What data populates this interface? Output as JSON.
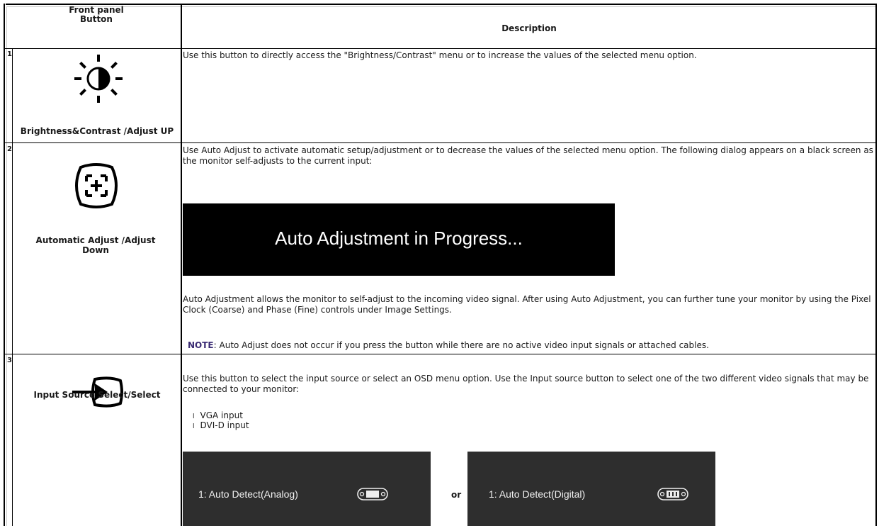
{
  "header": {
    "col1": "Front panel\nButton",
    "col2": "Description"
  },
  "rows": [
    {
      "num": "1",
      "icon": "brightness-contrast-icon",
      "label": "Brightness&Contrast /Adjust UP",
      "description": "Use this button to directly access the \"Brightness/Contrast\" menu or to increase the values of the selected menu option."
    },
    {
      "num": "2",
      "icon": "auto-adjust-icon",
      "label": "Automatic Adjust /Adjust Down",
      "description": "Use Auto Adjust to activate automatic setup/adjustment or to decrease the values of the selected menu option. The following dialog appears on a black screen as the monitor self-adjusts to the current input:",
      "dialog_text": "Auto Adjustment in Progress...",
      "description2": "Auto Adjustment allows the monitor to self-adjust to the incoming video signal. After using Auto Adjustment, you can further tune your monitor by using the Pixel Clock (Coarse) and Phase (Fine) controls under Image Settings.",
      "note_label": "NOTE",
      "note_text": ": Auto Adjust does not occur if you press the button while there are no active video input signals or attached cables."
    },
    {
      "num": "3",
      "icon": "input-source-icon",
      "label": "Input Source Select/Select",
      "description": "Use this button to select the input source or select an OSD menu option. Use the Input source button to select one of the two different video signals that may be connected to your monitor:",
      "bullets": [
        "VGA input",
        "DVI-D input"
      ],
      "bullet_glyph": "l",
      "osd_analog": "1: Auto Detect(Analog)",
      "osd_or": "or",
      "osd_digital": "1: Auto Detect(Digital)",
      "osd_analog_icon": "vga-connector-icon",
      "osd_digital_icon": "dvi-connector-icon"
    }
  ],
  "colors": {
    "border": "#000000",
    "note": "#3a2b73",
    "dialog_bg": "#000000",
    "osd_bg": "#2e2e2e"
  }
}
